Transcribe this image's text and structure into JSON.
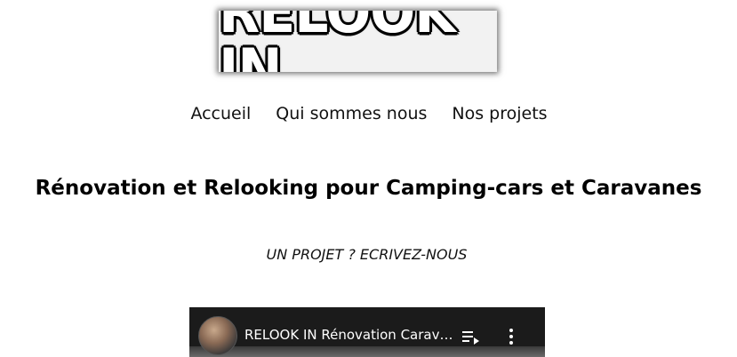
{
  "header": {
    "logo_text": "RELOOK IN"
  },
  "nav": {
    "items": [
      {
        "label": "Accueil"
      },
      {
        "label": "Qui sommes nous"
      },
      {
        "label": "Nos projets"
      }
    ]
  },
  "main": {
    "title": "Rénovation et Relooking pour Camping-cars et Caravanes",
    "cta": "UN PROJET ? ECRIVEZ-NOUS"
  },
  "video": {
    "title": "RELOOK IN Rénovation Caravanes et Camping-cars",
    "queue_icon": "add-to-queue-icon",
    "more_icon": "more-vertical-icon",
    "avatar_icon": "channel-avatar"
  }
}
